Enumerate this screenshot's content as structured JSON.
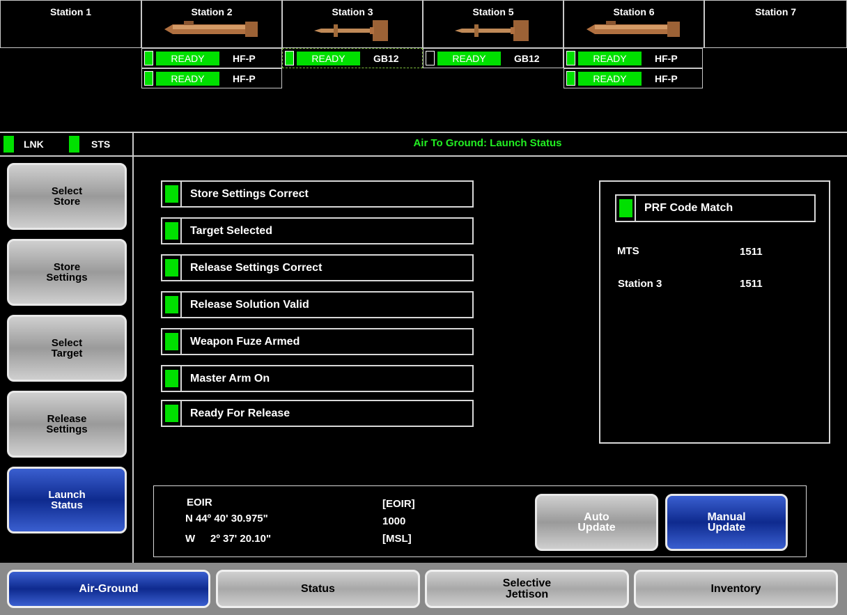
{
  "stations": [
    {
      "name": "Station 1",
      "weapon": "none"
    },
    {
      "name": "Station 2",
      "weapon": "hellfire-missile-icon"
    },
    {
      "name": "Station 3",
      "weapon": "guided-bomb-icon"
    },
    {
      "name": "Station 5",
      "weapon": "guided-bomb-icon"
    },
    {
      "name": "Station 6",
      "weapon": "hellfire-missile-icon"
    },
    {
      "name": "Station 7",
      "weapon": "none"
    }
  ],
  "store_rows": {
    "s2a": {
      "status": "READY",
      "type": "HF-P"
    },
    "s2b": {
      "status": "READY",
      "type": "HF-P"
    },
    "s3": {
      "status": "READY",
      "type": "GB12"
    },
    "s5": {
      "status": "READY",
      "type": "GB12"
    },
    "s6a": {
      "status": "READY",
      "type": "HF-P"
    },
    "s6b": {
      "status": "READY",
      "type": "HF-P"
    }
  },
  "indicators": {
    "lnk": "LNK",
    "sts": "STS"
  },
  "page_title": "Air To Ground: Launch Status",
  "left_menu": [
    "Select\nStore",
    "Store\nSettings",
    "Select\nTarget",
    "Release\nSettings",
    "Launch\nStatus"
  ],
  "checklist": [
    "Store Settings Correct",
    "Target Selected",
    "Release Settings Correct",
    "Release Solution Valid",
    "Weapon Fuze Armed",
    "Master Arm On",
    "Ready For Release"
  ],
  "prf": {
    "title": "PRF Code Match",
    "rows": [
      {
        "label": "MTS",
        "value": "1511"
      },
      {
        "label": "Station 3",
        "value": "1511"
      }
    ]
  },
  "target": {
    "sensor": "EOIR",
    "lat": "N 44º 40' 30.975\"",
    "lon_prefix": "W",
    "lon": "2º 37' 20.10\"",
    "src_label": "[EOIR]",
    "alt": "1000",
    "alt_ref": "[MSL]"
  },
  "update_buttons": {
    "auto": "Auto\nUpdate",
    "manual": "Manual\nUpdate"
  },
  "tabs": [
    "Air-Ground",
    "Status",
    "Selective\nJettison",
    "Inventory"
  ],
  "colors": {
    "ready_green": "#00e000",
    "title_green": "#22ee22",
    "active_blue": "#0e2a8e"
  }
}
